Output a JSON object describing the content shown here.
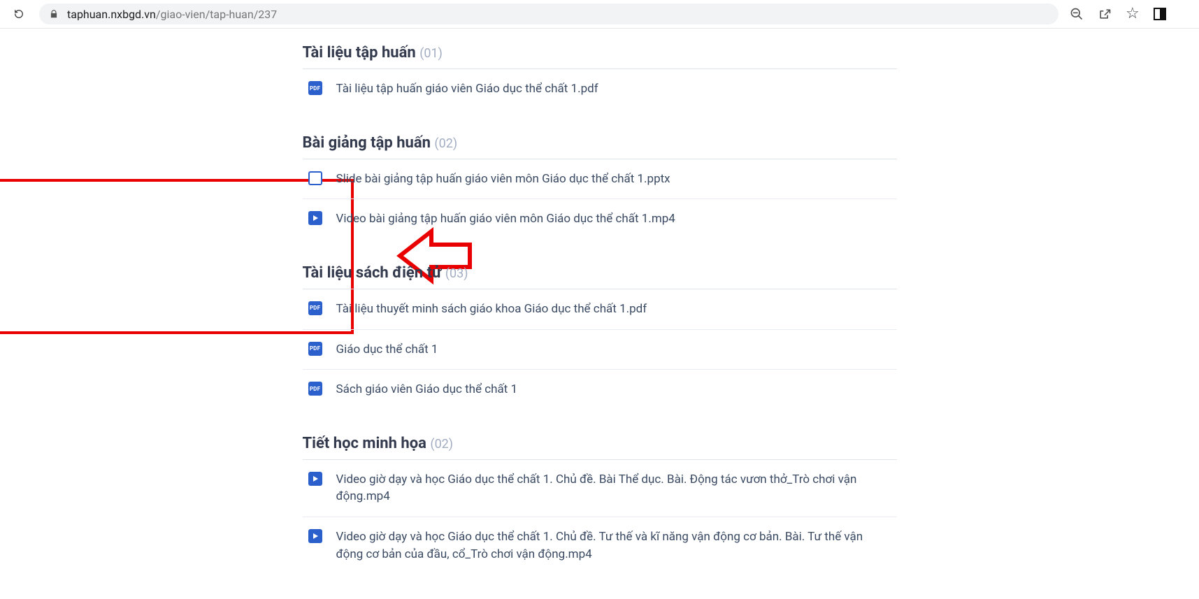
{
  "browser": {
    "url_domain": "taphuan.nxbgd.vn",
    "url_path": "/giao-vien/tap-huan/237"
  },
  "sections": [
    {
      "title": "Tài liệu tập huấn",
      "count": "(01)",
      "files": [
        {
          "icon": "pdf",
          "label": "Tài liệu tập huấn giáo viên Giáo dục thể chất 1.pdf"
        }
      ]
    },
    {
      "title": "Bài giảng tập huấn",
      "count": "(02)",
      "files": [
        {
          "icon": "pptx",
          "label": "Slide bài giảng tập huấn giáo viên môn Giáo dục thể chất 1.pptx"
        },
        {
          "icon": "mp4",
          "label": "Video bài giảng tập huấn giáo viên môn Giáo dục thể chất 1.mp4"
        }
      ]
    },
    {
      "title": "Tài liệu sách điện tử",
      "count": "(03)",
      "highlighted": true,
      "files": [
        {
          "icon": "pdf",
          "label": "Tài liệu thuyết minh sách giáo khoa Giáo dục thể chất 1.pdf"
        },
        {
          "icon": "pdf",
          "label": "Giáo dục thể chất 1"
        },
        {
          "icon": "pdf",
          "label": "Sách giáo viên Giáo dục thể chất 1"
        }
      ]
    },
    {
      "title": "Tiết học minh họa",
      "count": "(02)",
      "files": [
        {
          "icon": "mp4",
          "label": "Video giờ dạy và học Giáo dục thể chất 1. Chủ đề. Bài Thể dục. Bài. Động tác vươn thở_Trò chơi vận động.mp4"
        },
        {
          "icon": "mp4",
          "label": "Video giờ dạy và học Giáo dục thể chất 1. Chủ đề. Tư thế và kĩ năng vận động cơ bản. Bài. Tư thế vận động cơ bản của đầu, cổ_Trò chơi vận động.mp4"
        }
      ]
    }
  ]
}
